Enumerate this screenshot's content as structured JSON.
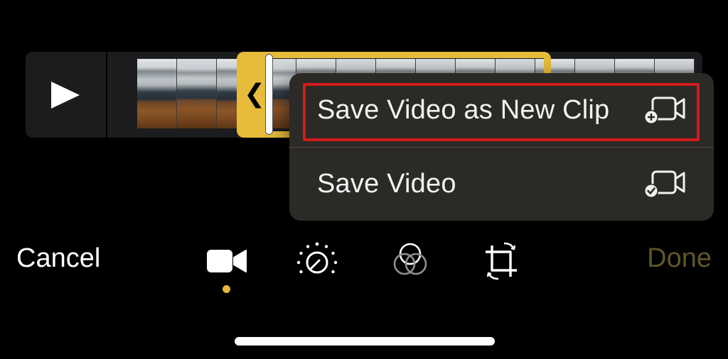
{
  "timeline": {
    "play_icon": "play-icon",
    "trim_handle_icon": "chevron-left-icon",
    "frame_count": 14,
    "accent_color": "#e6bc3a"
  },
  "menu": {
    "items": [
      {
        "label": "Save Video as New Clip",
        "icon": "video-plus-icon",
        "highlighted": true
      },
      {
        "label": "Save Video",
        "icon": "video-check-icon",
        "highlighted": false
      }
    ],
    "highlight_color": "#d11b1b"
  },
  "toolbar": {
    "cancel_label": "Cancel",
    "done_label": "Done",
    "tools": [
      {
        "icon": "video-camera-icon",
        "active": true
      },
      {
        "icon": "adjust-dial-icon",
        "active": false
      },
      {
        "icon": "filters-icon",
        "active": false
      },
      {
        "icon": "crop-rotate-icon",
        "active": false
      }
    ],
    "done_color": "#5f5628"
  }
}
